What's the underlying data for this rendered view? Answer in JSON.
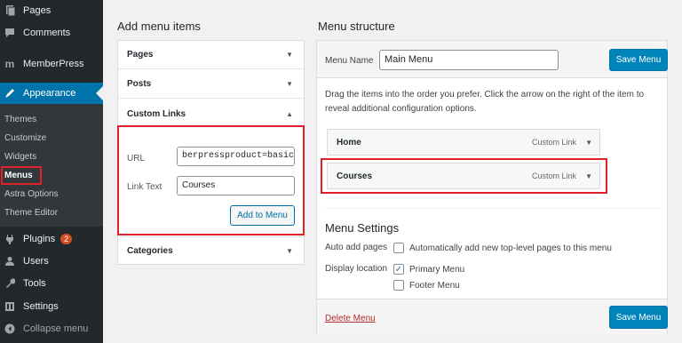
{
  "sidebar": {
    "items": [
      {
        "label": "Pages",
        "icon": "pages-icon"
      },
      {
        "label": "Comments",
        "icon": "comments-icon"
      },
      {
        "label": "MemberPress",
        "icon": "memberpress-icon"
      },
      {
        "label": "Appearance",
        "icon": "appearance-icon"
      },
      {
        "label": "Plugins",
        "icon": "plugins-icon",
        "badge": "2"
      },
      {
        "label": "Users",
        "icon": "users-icon"
      },
      {
        "label": "Tools",
        "icon": "tools-icon"
      },
      {
        "label": "Settings",
        "icon": "settings-icon"
      },
      {
        "label": "Collapse menu",
        "icon": "collapse-icon"
      }
    ],
    "submenu": [
      "Themes",
      "Customize",
      "Widgets",
      "Menus",
      "Astra Options",
      "Theme Editor"
    ],
    "memberpress_logo": "m"
  },
  "add_menu_items": {
    "title": "Add menu items",
    "sections": [
      "Pages",
      "Posts",
      "Custom Links",
      "Categories"
    ],
    "custom_links": {
      "url_label": "URL",
      "url_value": "berpressproduct=basic",
      "link_text_label": "Link Text",
      "link_text_value": "Courses",
      "add_button": "Add to Menu"
    }
  },
  "menu_structure": {
    "title": "Menu structure",
    "menu_name_label": "Menu Name",
    "menu_name_value": "Main Menu",
    "save_label": "Save Menu",
    "instructions": "Drag the items into the order you prefer. Click the arrow on the right of the item to reveal additional configuration options.",
    "items": [
      {
        "title": "Home",
        "type": "Custom Link"
      },
      {
        "title": "Courses",
        "type": "Custom Link"
      }
    ],
    "settings": {
      "title": "Menu Settings",
      "auto_add_label": "Auto add pages",
      "auto_add_option": "Automatically add new top-level pages to this menu",
      "display_location_label": "Display location",
      "primary_menu": "Primary Menu",
      "primary_checked": "✓",
      "footer_menu": "Footer Menu"
    },
    "delete_label": "Delete Menu"
  },
  "colors": {
    "accent": "#0073aa",
    "highlight": "#e0202a",
    "sidebar": "#23282d"
  }
}
